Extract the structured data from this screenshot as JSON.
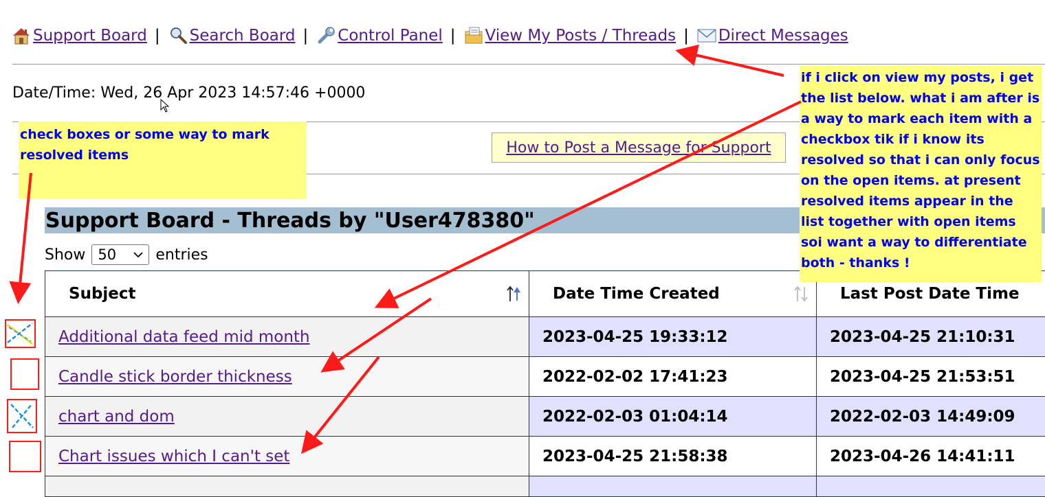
{
  "nav": {
    "items": [
      {
        "label": " Support Board",
        "icon": "home-icon"
      },
      {
        "label": " Search Board",
        "icon": "magnifier-icon"
      },
      {
        "label": " Control Panel",
        "icon": "wrench-icon"
      },
      {
        "label": " View My Posts / Threads",
        "icon": "posts-folder-icon"
      },
      {
        "label": " Direct Messages",
        "icon": "envelope-icon"
      }
    ],
    "separator": "|"
  },
  "datetime": "Date/Time: Wed, 26 Apr 2023 14:57:46 +0000",
  "howto_link": "How to Post a Message for Support",
  "board_title": "Support Board - Threads by \"User478380\"",
  "entries": {
    "prefix": "Show",
    "selected": "50",
    "suffix": "entries"
  },
  "table": {
    "headers": [
      "Subject",
      "Date Time Created",
      "Last Post Date Time"
    ],
    "rows": [
      {
        "subject": "Additional data feed mid month",
        "created": "2023-04-25 19:33:12",
        "last_post": "2023-04-25 21:10:31"
      },
      {
        "subject": "Candle stick border thickness",
        "created": "2022-02-02 17:41:23",
        "last_post": "2023-04-25 21:53:51"
      },
      {
        "subject": "chart and dom",
        "created": "2022-02-03 01:04:14",
        "last_post": "2022-02-03 14:49:09"
      },
      {
        "subject": "Chart issues which I can't set",
        "created": "2023-04-25 21:58:38",
        "last_post": "2023-04-26 14:41:11"
      }
    ]
  },
  "annotations": {
    "left_note": "check boxes or some way to mark resolved items",
    "right_note": "if i click on view my posts, i get the list below. what i am after is a way to mark each item with a checkbox tik if i know its resolved so that i can only focus on the open items. at present resolved items appear in the list together with open items soi want  a way to differentiate both - thanks !"
  },
  "colors": {
    "link": "#551a8b",
    "title_bar": "#a3bfd1",
    "note_bg": "#ffff80",
    "note_text": "#0000ee",
    "arrow": "#ff1a1a",
    "odd_row_date": "#e1e1fd"
  }
}
